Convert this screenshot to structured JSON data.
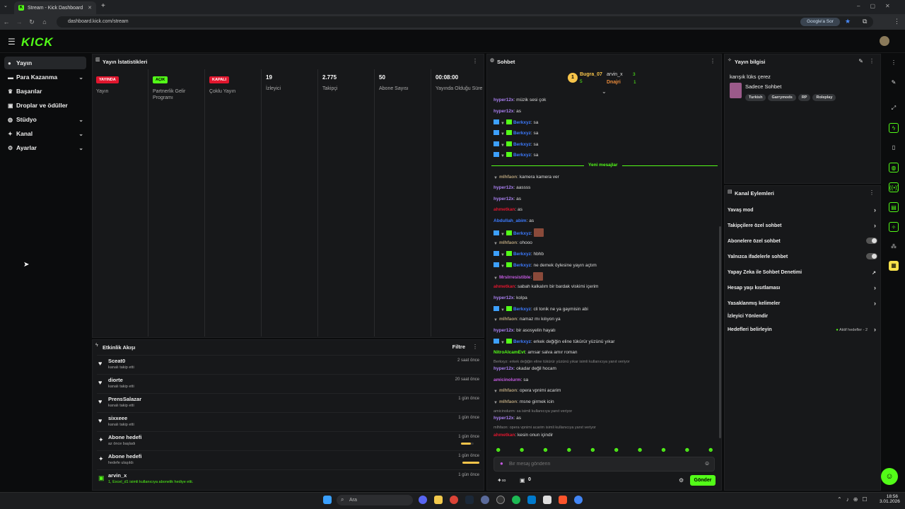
{
  "browser": {
    "tab_title": "Stream - Kick Dashboard",
    "new_tab": "+",
    "url": "dashboard.kick.com/stream",
    "google_sor": "Google'a Sor"
  },
  "app": {
    "logo": "KICK"
  },
  "sidebar": {
    "items": [
      {
        "label": "Yayın"
      },
      {
        "label": "Para Kazanma"
      },
      {
        "label": "Başarılar"
      },
      {
        "label": "Droplar ve ödüller"
      },
      {
        "label": "Stüdyo"
      },
      {
        "label": "Kanal"
      },
      {
        "label": "Ayarlar"
      }
    ]
  },
  "stats": {
    "title": "Yayın İstatistikleri",
    "cols": [
      {
        "badge": "YAYINDA",
        "label": "Yayın"
      },
      {
        "badge": "AÇIK",
        "label": "Partnerlik Gelir Programı"
      },
      {
        "badge": "KAPALI",
        "label": "Çoklu Yayın"
      },
      {
        "value": "19",
        "label": "İzleyici"
      },
      {
        "value": "2.775",
        "label": "Takipçi"
      },
      {
        "value": "50",
        "label": "Abone Sayısı"
      },
      {
        "value": "00:08:00",
        "label": "Yayında Olduğu Süre"
      }
    ]
  },
  "events": {
    "title": "Etkinlik Akışı",
    "filter": "Filtre",
    "rows": [
      {
        "name": "Sceat0",
        "sub": "kanalı takip etti",
        "time": "2 saat önce",
        "icon": "heart-icon"
      },
      {
        "name": "diorte",
        "sub": "kanalı takip etti",
        "time": "20 saat önce",
        "icon": "heart-icon"
      },
      {
        "name": "PrensSalazar",
        "sub": "kanalı takip etti",
        "time": "1 gün önce",
        "icon": "heart-icon"
      },
      {
        "name": "sixxeee",
        "sub": "kanalı takip etti",
        "time": "1 gün önce",
        "icon": "heart-icon"
      },
      {
        "name": "Abone hedefi",
        "sub": "az önce başladı",
        "time": "1 gün önce",
        "icon": "sparkle-icon",
        "progress": 0.8
      },
      {
        "name": "Abone hedefi",
        "sub": "hedefe ulaşıldı",
        "time": "1 gün önce",
        "icon": "sparkle-icon",
        "progress": 1.0
      },
      {
        "name": "arvin_x",
        "sub": "1, Excel_d1 isimli kullanıcıya abonelik hediye etti.",
        "time": "1 gün önce",
        "icon": "gift-icon"
      }
    ]
  },
  "chat": {
    "title": "Sohbet",
    "top": {
      "user1": "Bugra_07",
      "user1_count": "5",
      "user2": "arvin_x",
      "user2_count": "3",
      "user3": "Dnajri",
      "user3_count": "1"
    },
    "new_messages": "Yeni mesajlar",
    "messages": [
      {
        "user": "hyper12x",
        "text": ": müzik sesi çok"
      },
      {
        "user": "hyper12x",
        "text": ": as"
      },
      {
        "user": "Berkxyz",
        "text": ": sa"
      },
      {
        "user": "Berkxyz",
        "text": ": sa"
      },
      {
        "user": "Berkxyz",
        "text": ": sa"
      },
      {
        "user": "Berkxyz",
        "text": ": sa"
      },
      {
        "user": "mlhfaon",
        "text": ": kamera kamera ver"
      },
      {
        "user": "hyper12x",
        "text": ": aassss"
      },
      {
        "user": "hyper12x",
        "text": ": as"
      },
      {
        "user": "ahmetkan",
        "text": ": as"
      },
      {
        "user": "Abdullah_abim",
        "text": ": as"
      },
      {
        "user": "Berkxyz",
        "text": ":"
      },
      {
        "user": "mlhfaon",
        "text": ": ohooo"
      },
      {
        "user": "Berkxyz",
        "text": ": hbhb"
      },
      {
        "user": "Berkxyz",
        "text": ": ne demek öylesine yayın açtım"
      },
      {
        "user": "MrsIrresistible",
        "text": ":"
      },
      {
        "user": "ahmetkan",
        "text": ": sabah kalkalım bir bardak viskimi içerim"
      },
      {
        "user": "hyper12x",
        "text": ": kolpa"
      },
      {
        "user": "Berkxyz",
        "text": ": cli tonik ne ya gaymisin abi"
      },
      {
        "user": "mlhfaon",
        "text": ": namaz mı kılıyon ya"
      },
      {
        "user": "hyper12x",
        "text": ": bir asosyelin hayatı"
      },
      {
        "user": "Berkxyz",
        "text": ": erkek değiğin eline tükürür yüzünü yıkar"
      },
      {
        "user": "NitroAlcamEvt",
        "text": ": amsar salva amır roman"
      },
      {
        "user": "hyper12x",
        "text": ": okadar değil hocam"
      },
      {
        "user": "amicinolurm",
        "text": ": sa"
      },
      {
        "user": "mlhfaon",
        "text": ": opera vpnimi acarim"
      },
      {
        "user": "mlhfaon",
        "text": ": msne girmek icin"
      },
      {
        "user": "hyper12x",
        "text": ": as"
      },
      {
        "user": "ahmetkan",
        "text": ": kesin onun içindir"
      }
    ],
    "replies": [
      "Berkxyz: erkek değiğin eline tükürür yüzünü yıkar isimli kullanıcıya yanıt veriyor",
      "amicinolurm: sa isimli kullanıcıya yanıt veriyor",
      "mlhfaon: opera vpnimi acarim isimli kullanıcıya yanıt veriyor"
    ],
    "input_placeholder": "Bir mesaj gönderin",
    "send": "Gönder",
    "points": "0"
  },
  "info": {
    "title": "Yayın bilgisi",
    "stream_title": "karışık lüks çerez",
    "mode": "Sadece Sohbet",
    "tags": [
      "Turkish",
      "Garrymods",
      "RP",
      "Roleplay"
    ]
  },
  "actions": {
    "title": "Kanal Eylemleri",
    "rows": [
      {
        "label": "Yavaş mod",
        "kind": "chevron"
      },
      {
        "label": "Takipçilere özel sohbet",
        "kind": "chevron"
      },
      {
        "label": "Abonelere özel sohbet",
        "kind": "toggle"
      },
      {
        "label": "Yalnızca ifadelerle sohbet",
        "kind": "toggle"
      },
      {
        "label": "Yapay Zeka ile Sohbet Denetimi",
        "kind": "external"
      },
      {
        "label": "Hesap yaşı kısıtlaması",
        "kind": "chevron"
      },
      {
        "label": "Yasaklanmış kelimeler",
        "kind": "chevron"
      },
      {
        "label": "İzleyici Yönlendir",
        "kind": "none"
      },
      {
        "label": "Hedefleri belirleyin",
        "kind": "chevron"
      }
    ],
    "goals_status": "Aktif hedefler - 2"
  },
  "taskbar": {
    "search": "Ara",
    "time": "18:56",
    "date": "3.01.2026"
  }
}
